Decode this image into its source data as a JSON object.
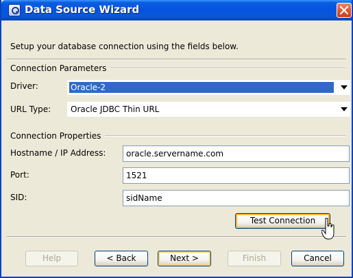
{
  "window": {
    "title": "Data Source Wizard"
  },
  "instructions": "Setup your database connection using the fields below.",
  "connection_parameters": {
    "heading": "Connection Parameters",
    "driver_label": "Driver:",
    "driver_value": "Oracle-2",
    "url_type_label": "URL Type:",
    "url_type_value": "Oracle JDBC Thin URL"
  },
  "connection_properties": {
    "heading": "Connection Properties",
    "hostname_label": "Hostname / IP Address:",
    "hostname_value": "oracle.servername.com",
    "port_label": "Port:",
    "port_value": "1521",
    "sid_label": "SID:",
    "sid_value": "sidName"
  },
  "test_connection_label": "Test Connection",
  "footer": {
    "help": "Help",
    "back": "< Back",
    "next": "Next >",
    "finish": "Finish",
    "cancel": "Cancel"
  },
  "icons": {
    "app": "database-wizard-icon",
    "close": "close-icon",
    "dropdown": "chevron-down-icon",
    "cursor": "mouse-pointer-icon"
  },
  "colors": {
    "titlebar": "#0553df",
    "close_button": "#e2562c",
    "selection": "#316ac5",
    "dialog_bg": "#ece9d8"
  }
}
